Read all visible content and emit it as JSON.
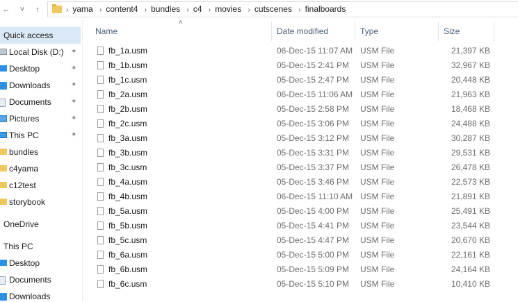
{
  "address_bar": {
    "back_glyph": "←",
    "forward_glyph": "→",
    "recent_glyph": "˅",
    "up_glyph": "↑",
    "breadcrumbs": [
      "yama",
      "content4",
      "bundles",
      "c4",
      "movies",
      "cutscenes",
      "finalboards"
    ]
  },
  "nav_pane": {
    "items": [
      {
        "label": "Quick access",
        "icon": "star-icon",
        "pinned": false,
        "header": true,
        "selected": true
      },
      {
        "label": "Local Disk (D:)",
        "icon": "drive-icon",
        "pinned": true
      },
      {
        "label": "Desktop",
        "icon": "desktop-icon",
        "pinned": true
      },
      {
        "label": "Downloads",
        "icon": "download-icon",
        "pinned": true
      },
      {
        "label": "Documents",
        "icon": "documents-icon",
        "pinned": true
      },
      {
        "label": "Pictures",
        "icon": "pictures-icon",
        "pinned": true
      },
      {
        "label": "This PC",
        "icon": "pc-icon",
        "pinned": true
      },
      {
        "label": "bundles",
        "icon": "folder-icon",
        "pinned": false
      },
      {
        "label": "c4yama",
        "icon": "folder-icon",
        "pinned": false
      },
      {
        "label": "c12test",
        "icon": "folder-icon",
        "pinned": false
      },
      {
        "label": "storybook",
        "icon": "folder-icon",
        "pinned": false
      },
      {
        "label": "OneDrive",
        "icon": "onedrive-icon",
        "pinned": false,
        "header": true
      },
      {
        "label": "This PC",
        "icon": "pc-icon",
        "pinned": false,
        "header": true
      },
      {
        "label": "Desktop",
        "icon": "desktop-icon",
        "pinned": false
      },
      {
        "label": "Documents",
        "icon": "documents-icon",
        "pinned": false
      },
      {
        "label": "Downloads",
        "icon": "download-icon",
        "pinned": false
      }
    ],
    "pin_glyph": "📌"
  },
  "file_list": {
    "columns": {
      "name": "Name",
      "date": "Date modified",
      "type": "Type",
      "size": "Size"
    },
    "sort_glyph": "˄",
    "files": [
      {
        "name": "fb_1a.usm",
        "date": "06-Dec-15 11:07 AM",
        "type": "USM File",
        "size": "21,397 KB"
      },
      {
        "name": "fb_1b.usm",
        "date": "05-Dec-15 2:41 PM",
        "type": "USM File",
        "size": "32,967 KB"
      },
      {
        "name": "fb_1c.usm",
        "date": "05-Dec-15 2:47 PM",
        "type": "USM File",
        "size": "20,448 KB"
      },
      {
        "name": "fb_2a.usm",
        "date": "06-Dec-15 11:06 AM",
        "type": "USM File",
        "size": "21,963 KB"
      },
      {
        "name": "fb_2b.usm",
        "date": "05-Dec-15 2:58 PM",
        "type": "USM File",
        "size": "18,468 KB"
      },
      {
        "name": "fb_2c.usm",
        "date": "05-Dec-15 3:06 PM",
        "type": "USM File",
        "size": "24,488 KB"
      },
      {
        "name": "fb_3a.usm",
        "date": "05-Dec-15 3:12 PM",
        "type": "USM File",
        "size": "30,287 KB"
      },
      {
        "name": "fb_3b.usm",
        "date": "05-Dec-15 3:31 PM",
        "type": "USM File",
        "size": "29,531 KB"
      },
      {
        "name": "fb_3c.usm",
        "date": "05-Dec-15 3:37 PM",
        "type": "USM File",
        "size": "26,478 KB"
      },
      {
        "name": "fb_4a.usm",
        "date": "05-Dec-15 3:46 PM",
        "type": "USM File",
        "size": "22,573 KB"
      },
      {
        "name": "fb_4b.usm",
        "date": "06-Dec-15 11:10 AM",
        "type": "USM File",
        "size": "21,891 KB"
      },
      {
        "name": "fb_5a.usm",
        "date": "05-Dec-15 4:00 PM",
        "type": "USM File",
        "size": "25,491 KB"
      },
      {
        "name": "fb_5b.usm",
        "date": "05-Dec-15 4:41 PM",
        "type": "USM File",
        "size": "23,544 KB"
      },
      {
        "name": "fb_5c.usm",
        "date": "05-Dec-15 4:47 PM",
        "type": "USM File",
        "size": "20,670 KB"
      },
      {
        "name": "fb_6a.usm",
        "date": "05-Dec-15 5:00 PM",
        "type": "USM File",
        "size": "22,161 KB"
      },
      {
        "name": "fb_6b.usm",
        "date": "05-Dec-15 5:09 PM",
        "type": "USM File",
        "size": "24,164 KB"
      },
      {
        "name": "fb_6c.usm",
        "date": "05-Dec-15 5:10 PM",
        "type": "USM File",
        "size": "10,410 KB"
      }
    ]
  },
  "colors": {
    "selection": "#dbe9f7",
    "header_text": "#4c607a",
    "folder": "#f0c75e"
  }
}
